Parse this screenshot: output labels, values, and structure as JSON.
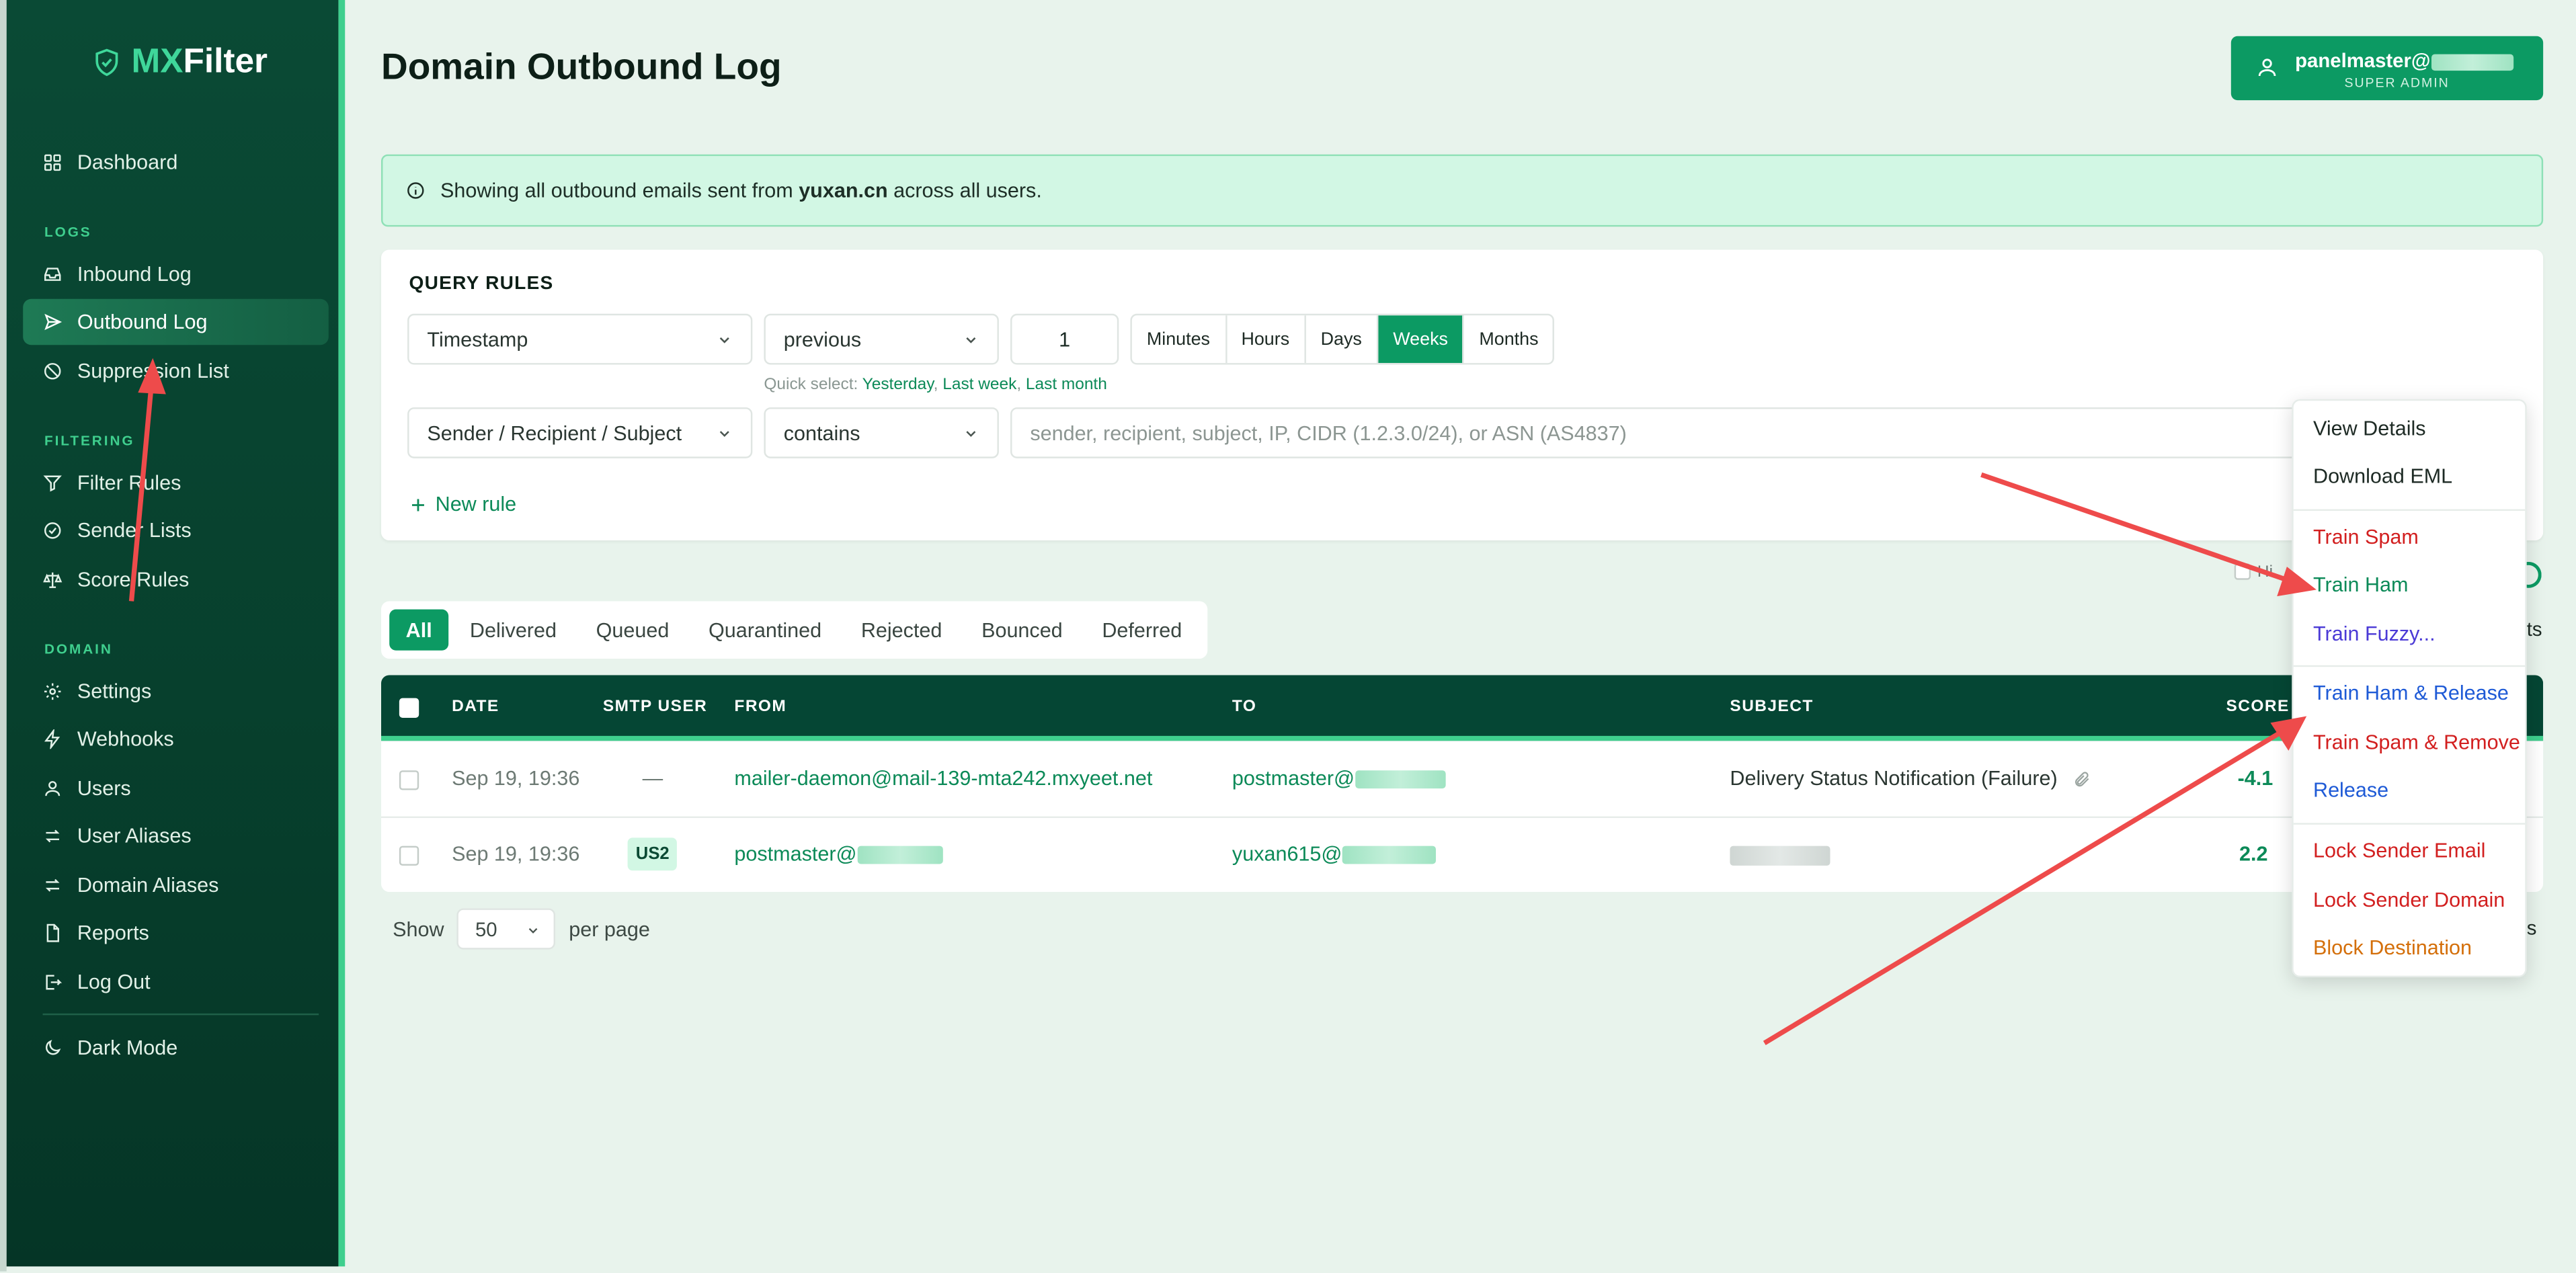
{
  "app": {
    "logo_mx": "MX",
    "logo_filter": "Filter"
  },
  "sidebar": {
    "dashboard": "Dashboard",
    "section_logs": "LOGS",
    "inbound": "Inbound Log",
    "outbound": "Outbound Log",
    "suppression": "Suppression List",
    "section_filtering": "FILTERING",
    "filter_rules": "Filter Rules",
    "sender_lists": "Sender Lists",
    "score_rules": "Score Rules",
    "section_domain": "DOMAIN",
    "settings": "Settings",
    "webhooks": "Webhooks",
    "users": "Users",
    "user_aliases": "User Aliases",
    "domain_aliases": "Domain Aliases",
    "reports": "Reports",
    "logout": "Log Out",
    "dark_mode": "Dark Mode"
  },
  "header": {
    "title": "Domain Outbound Log",
    "user_name": "panelmaster@",
    "user_role": "SUPER ADMIN"
  },
  "banner": {
    "prefix": "Showing all outbound emails sent from ",
    "domain": "yuxan.cn",
    "suffix": " across all users."
  },
  "query": {
    "title": "QUERY RULES",
    "rule1_field": "Timestamp",
    "rule1_op": "previous",
    "rule1_value": "1",
    "units": [
      "Minutes",
      "Hours",
      "Days",
      "Weeks",
      "Months"
    ],
    "active_unit": "Weeks",
    "quick_label": "Quick select: ",
    "quick_yesterday": "Yesterday",
    "quick_week": "Last week",
    "quick_month": "Last month",
    "rule2_field": "Sender / Recipient / Subject",
    "rule2_op": "contains",
    "rule2_placeholder": "sender, recipient, subject, IP, CIDR (1.2.3.0/24), or ASN (AS4837)",
    "new_rule": "New rule"
  },
  "tabs": [
    "All",
    "Delivered",
    "Queued",
    "Quarantined",
    "Rejected",
    "Bounced",
    "Deferred"
  ],
  "table": {
    "headers": {
      "date": "DATE",
      "smtp_user": "SMTP USER",
      "from": "FROM",
      "to": "TO",
      "subject": "SUBJECT",
      "score": "SCORE"
    },
    "rows": [
      {
        "date": "Sep 19, 19:36",
        "smtp_user": "—",
        "from": "mailer-daemon@mail-139-mta242.mxyeet.net",
        "to": "postmaster@",
        "subject": "Delivery Status Notification (Failure)",
        "score": "-4.1"
      },
      {
        "date": "Sep 19, 19:36",
        "smtp_user": "US2",
        "from": "postmaster@",
        "to": "yuxan615@",
        "subject": "",
        "score": "2.2"
      }
    ]
  },
  "pagination": {
    "show": "Show",
    "per_page_value": "50",
    "per_page": "per page"
  },
  "peek": {
    "hide_label": "Hi",
    "right_text": "ts",
    "right_text2": "s"
  },
  "context_menu": {
    "view_details": "View Details",
    "download_eml": "Download EML",
    "train_spam": "Train Spam",
    "train_ham": "Train Ham",
    "train_fuzzy": "Train Fuzzy...",
    "train_ham_release": "Train Ham & Release",
    "train_spam_remove": "Train Spam & Remove",
    "release": "Release",
    "lock_sender_email": "Lock Sender Email",
    "lock_sender_domain": "Lock Sender Domain",
    "block_destination": "Block Destination"
  },
  "colors": {
    "primary": "#0c9a63",
    "sidebar": "#0a4a35",
    "table_header": "#054634",
    "accent": "#3fcf8e",
    "danger": "#d21f1f",
    "annotation_arrow": "#ee4b4b"
  }
}
